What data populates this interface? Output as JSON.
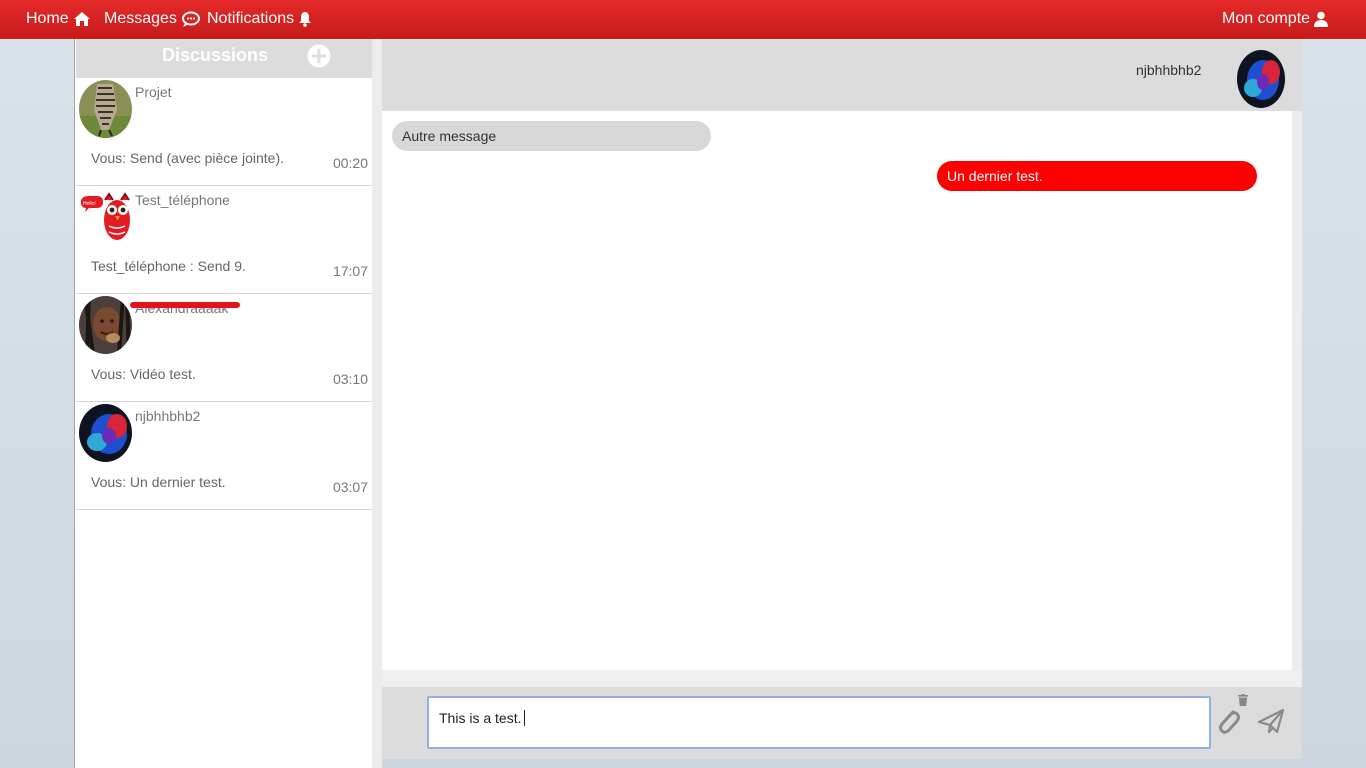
{
  "nav": {
    "home": "Home",
    "messages": "Messages",
    "notifications": "Notifications",
    "account": "Mon compte",
    "colors": {
      "bar": "#d42020",
      "text": "#ffffff"
    }
  },
  "sidebar": {
    "title": "Discussions",
    "conversations": [
      {
        "name": "Projet",
        "last": "Vous: Send (avec pièce jointe).",
        "time": "00:20"
      },
      {
        "name": "Test_téléphone",
        "last": "Test_téléphone : Send 9.",
        "time": "17:07"
      },
      {
        "name": "Alexandraaaak",
        "last": "Vous: Vidéo test.",
        "time": "03:10"
      },
      {
        "name": "njbhhbhb2",
        "last": "Vous: Un dernier test.",
        "time": "03:07"
      }
    ]
  },
  "chat": {
    "contact": "njbhhbhb2",
    "messages": [
      {
        "direction": "in",
        "text": "Autre message"
      },
      {
        "direction": "out",
        "text": "Un dernier test."
      }
    ],
    "input_value": "This is a test.",
    "colors": {
      "outgoing": "#ff0000",
      "incoming": "#d8d8d8"
    }
  }
}
